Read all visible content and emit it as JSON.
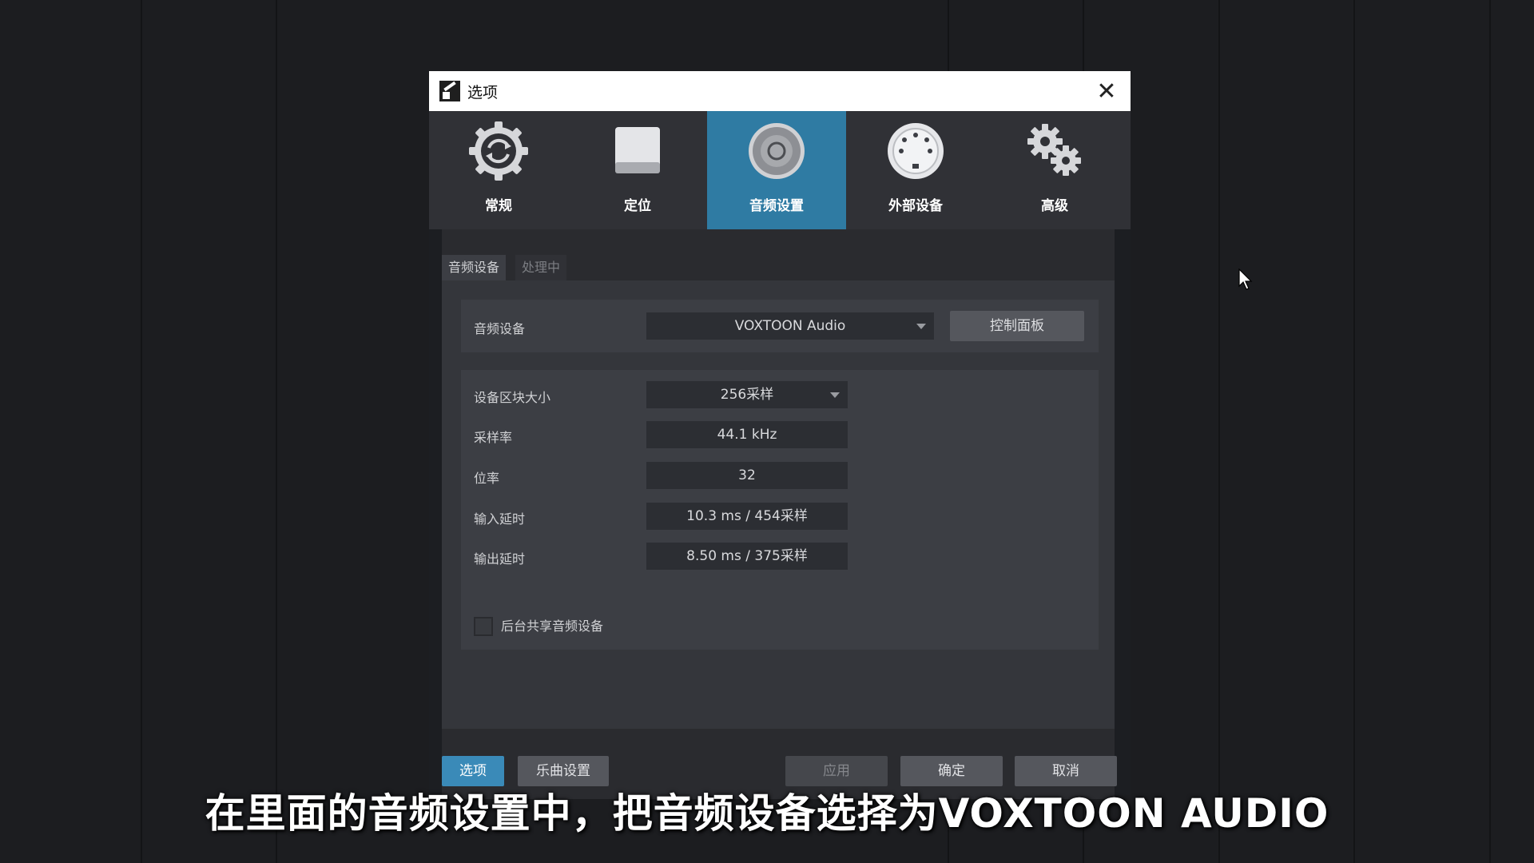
{
  "dialog": {
    "title": "选项",
    "close_icon": "close-icon"
  },
  "categories": [
    {
      "label": "常规",
      "icon": "general-gear-icon",
      "active": false
    },
    {
      "label": "定位",
      "icon": "drive-icon",
      "active": false
    },
    {
      "label": "音频设置",
      "icon": "speaker-icon",
      "active": true
    },
    {
      "label": "外部设备",
      "icon": "midi-port-icon",
      "active": false
    },
    {
      "label": "高级",
      "icon": "advanced-gears-icon",
      "active": false
    }
  ],
  "subtabs": {
    "device": "音频设备",
    "processing": "处理中"
  },
  "audio_device": {
    "label": "音频设备",
    "value": "VOXTOON Audio",
    "control_panel_label": "控制面板"
  },
  "settings": {
    "block_size": {
      "label": "设备区块大小",
      "value": "256采样"
    },
    "sample_rate": {
      "label": "采样率",
      "value": "44.1 kHz"
    },
    "bit_depth": {
      "label": "位率",
      "value": "32"
    },
    "input_latency": {
      "label": "输入延时",
      "value": "10.3 ms / 454采样"
    },
    "output_latency": {
      "label": "输出延时",
      "value": "8.50 ms / 375采样"
    }
  },
  "share_device": {
    "label": "后台共享音频设备",
    "checked": false
  },
  "bottom_buttons": {
    "options": "选项",
    "song_settings": "乐曲设置",
    "apply": "应用",
    "ok": "确定",
    "cancel": "取消"
  },
  "subtitle": "在里面的音频设置中，把音频设备选择为VOXTOON AUDIO",
  "colors": {
    "accent": "#2f7ba3",
    "button_active": "#3a8ab8",
    "background": "#1c1d20",
    "panel": "#34363b"
  }
}
